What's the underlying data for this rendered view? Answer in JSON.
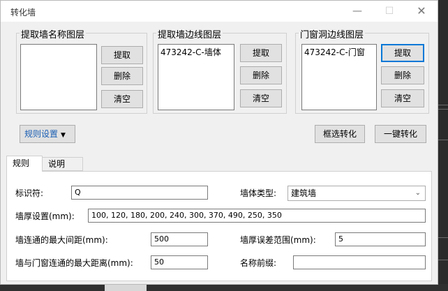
{
  "window": {
    "title": "转化墙",
    "minimize_icon": "minimize-icon",
    "maximize_icon": "maximize-icon",
    "close_icon": "close-icon"
  },
  "groups": {
    "name_layer": {
      "label": "提取墙名称图层",
      "items": [],
      "extract": "提取",
      "delete": "删除",
      "clear": "清空"
    },
    "wall_edge_layer": {
      "label": "提取墙边线图层",
      "items": [
        "473242-C-墙体"
      ],
      "extract": "提取",
      "delete": "删除",
      "clear": "清空"
    },
    "door_window_layer": {
      "label": "门窗洞边线图层",
      "items": [
        "473242-C-门窗"
      ],
      "extract": "提取",
      "delete": "删除",
      "clear": "清空"
    }
  },
  "rules_button": {
    "label": "规则设置",
    "caret_icon": "caret-down-icon"
  },
  "actions": {
    "box_select": "框选转化",
    "one_click": "一键转化"
  },
  "tabs": [
    "规则",
    "说明"
  ],
  "form": {
    "identifier_label": "标识符:",
    "identifier_value": "Q",
    "wall_type_label": "墙体类型:",
    "wall_type_value": "建筑墙",
    "thickness_label": "墙厚设置(mm):",
    "thickness_value": "100, 120, 180, 200, 240, 300, 370, 490, 250, 350",
    "max_gap_label": "墙连通的最大间距(mm):",
    "max_gap_value": "500",
    "thickness_tol_label": "墙厚误差范围(mm):",
    "thickness_tol_value": "5",
    "door_dist_label": "墙与门窗连通的最大距离(mm):",
    "door_dist_value": "50",
    "prefix_label": "名称前缀:",
    "prefix_value": ""
  }
}
